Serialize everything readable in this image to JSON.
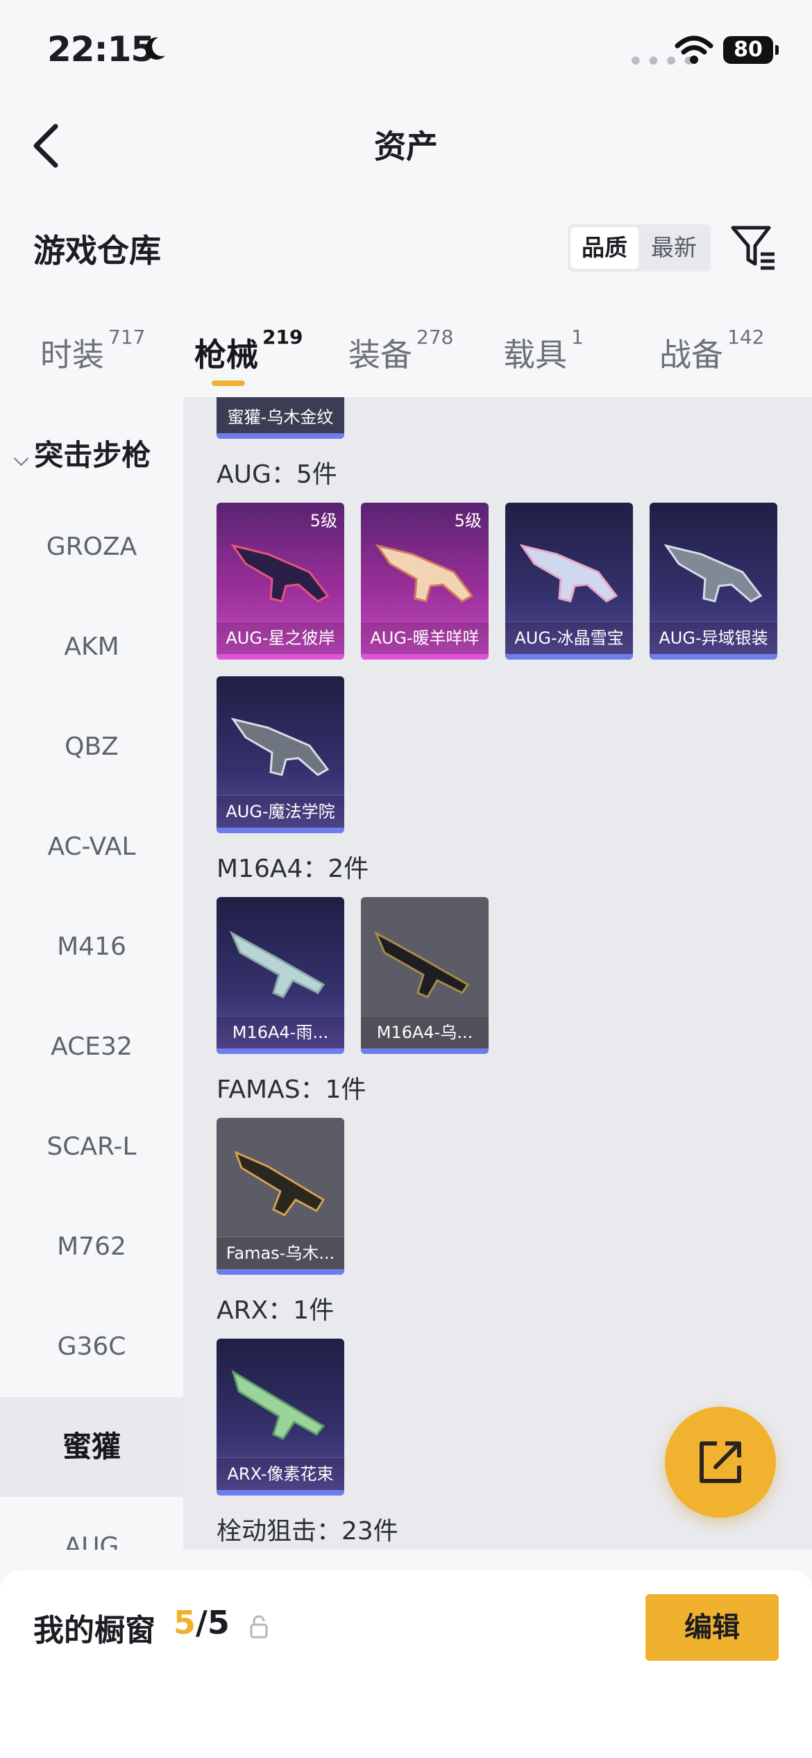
{
  "status_bar": {
    "time": "22:15",
    "battery": "80"
  },
  "nav": {
    "title": "资产"
  },
  "warehouse": {
    "title": "游戏仓库",
    "sort_options": [
      "品质",
      "最新"
    ]
  },
  "tabs": [
    {
      "label": "时装",
      "count": "717"
    },
    {
      "label": "枪械",
      "count": "219",
      "active": true
    },
    {
      "label": "装备",
      "count": "278"
    },
    {
      "label": "载具",
      "count": "1"
    },
    {
      "label": "战备",
      "count": "142"
    }
  ],
  "sidebar": {
    "category": "突击步枪",
    "items": [
      "GROZA",
      "AKM",
      "QBZ",
      "AC-VAL",
      "M416",
      "ACE32",
      "SCAR-L",
      "M762",
      "G36C",
      "蜜獾",
      "AUG"
    ],
    "active": "蜜獾"
  },
  "content": {
    "partial_card_label": "蜜獾-乌木金纹",
    "groups": [
      {
        "title": "AUG：5件",
        "items": [
          {
            "label": "AUG-星之彼岸",
            "level": "5级"
          },
          {
            "label": "AUG-暖羊咩咩",
            "level": "5级"
          },
          {
            "label": "AUG-冰晶雪宝"
          },
          {
            "label": "AUG-异域银装"
          },
          {
            "label": "AUG-魔法学院"
          }
        ]
      },
      {
        "title": "M16A4：2件",
        "items": [
          {
            "label": "M16A4-雨..."
          },
          {
            "label": "M16A4-乌..."
          }
        ]
      },
      {
        "title": "FAMAS：1件",
        "items": [
          {
            "label": "Famas-乌木..."
          }
        ]
      },
      {
        "title": "ARX：1件",
        "items": [
          {
            "label": "ARX-像素花束"
          }
        ]
      },
      {
        "title": "栓动狙击：23件",
        "items": []
      }
    ]
  },
  "bottom": {
    "label": "我的橱窗",
    "current": "5",
    "total": "/5",
    "edit": "编辑"
  },
  "colors": {
    "accent": "#f0b12f",
    "epic": "#c64ac3",
    "rare": "#6f7dea"
  }
}
